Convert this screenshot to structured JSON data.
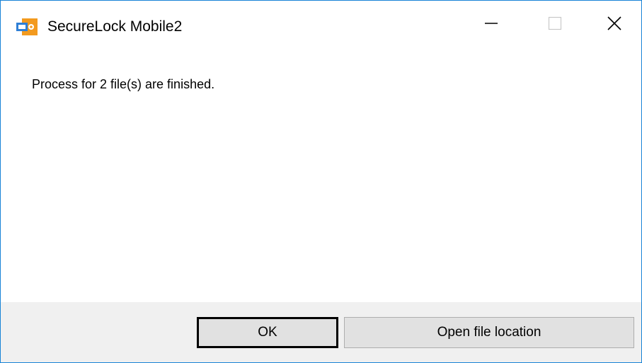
{
  "window": {
    "title": "SecureLock Mobile2",
    "icon": "securelock-app-icon",
    "controls": {
      "minimize": "minimize-icon",
      "maximize": "maximize-icon",
      "close": "close-icon"
    }
  },
  "dialog": {
    "message": "Process for 2 file(s) are finished."
  },
  "buttons": {
    "ok_label": "OK",
    "open_location_label": "Open file location"
  },
  "colors": {
    "window_border": "#1883d7",
    "footer_bg": "#f0f0f0",
    "button_bg": "#e1e1e1",
    "icon_orange": "#f39a1e",
    "icon_blue": "#2f7fd6"
  }
}
